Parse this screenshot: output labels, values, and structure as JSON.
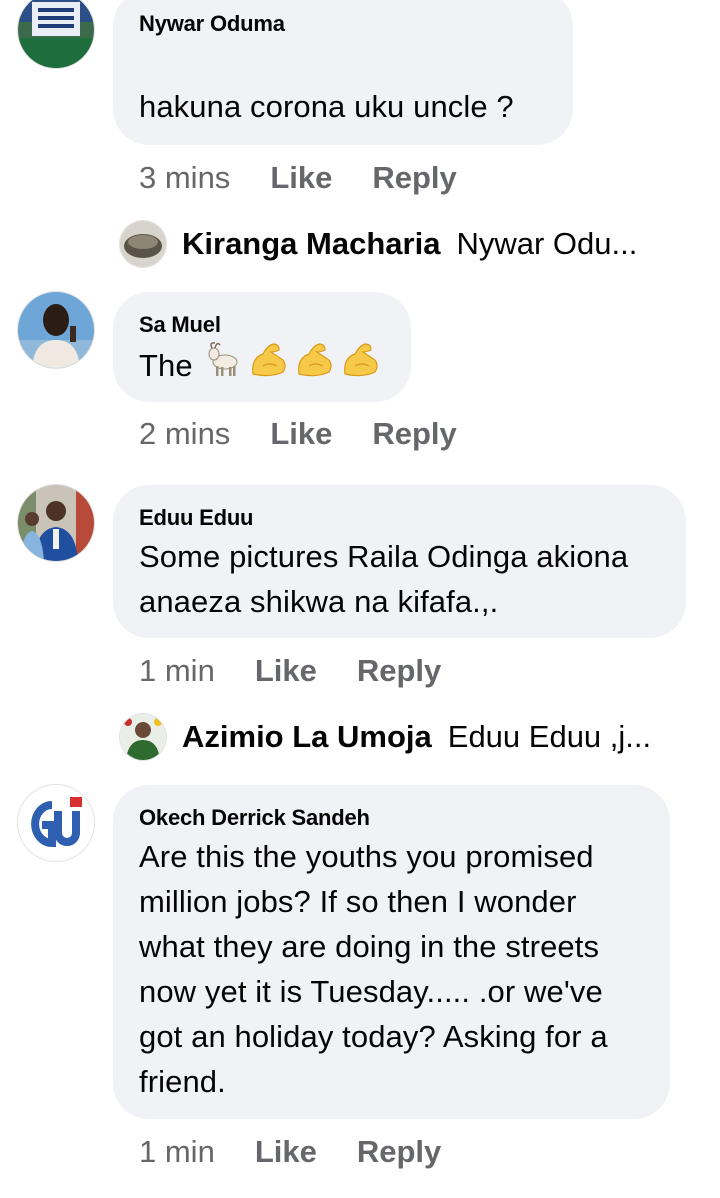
{
  "comments": [
    {
      "author": "Nywar Oduma",
      "text": "hakuna corona uku uncle ?",
      "time": "3 mins",
      "like": "Like",
      "reply": "Reply",
      "avatar_icon": "crowd-photo-avatar",
      "reply_preview": {
        "author": "Kiranga Macharia",
        "snippet": "Nywar Odu...",
        "avatar_icon": "stone-photo-avatar"
      }
    },
    {
      "author": "Sa Muel",
      "text": "The",
      "emojis": [
        "goat",
        "flexed-biceps",
        "flexed-biceps",
        "flexed-biceps"
      ],
      "time": "2 mins",
      "like": "Like",
      "reply": "Reply",
      "avatar_icon": "person-photo-avatar"
    },
    {
      "author": "Eduu Eduu",
      "text": "Some pictures Raila Odinga akiona anaeza shikwa na kifafa.,.",
      "time": "1 min",
      "like": "Like",
      "reply": "Reply",
      "avatar_icon": "politician-photo-avatar",
      "reply_preview": {
        "author": "Azimio La Umoja",
        "snippet": "Eduu Eduu ,j...",
        "avatar_icon": "logo-photo-avatar"
      }
    },
    {
      "author": "Okech Derrick Sandeh",
      "text": "Are this the youths you promised million jobs? If so then I wonder what they are doing in the streets now yet it is Tuesday..... .or we've got an holiday today? Asking for a friend.",
      "time": "1 min",
      "like": "Like",
      "reply": "Reply",
      "avatar_icon": "gu-logo-avatar",
      "avatar_text": "GU"
    }
  ],
  "colors": {
    "bubble": "#f0f2f5",
    "meta_text": "#65676b",
    "text": "#050505"
  }
}
